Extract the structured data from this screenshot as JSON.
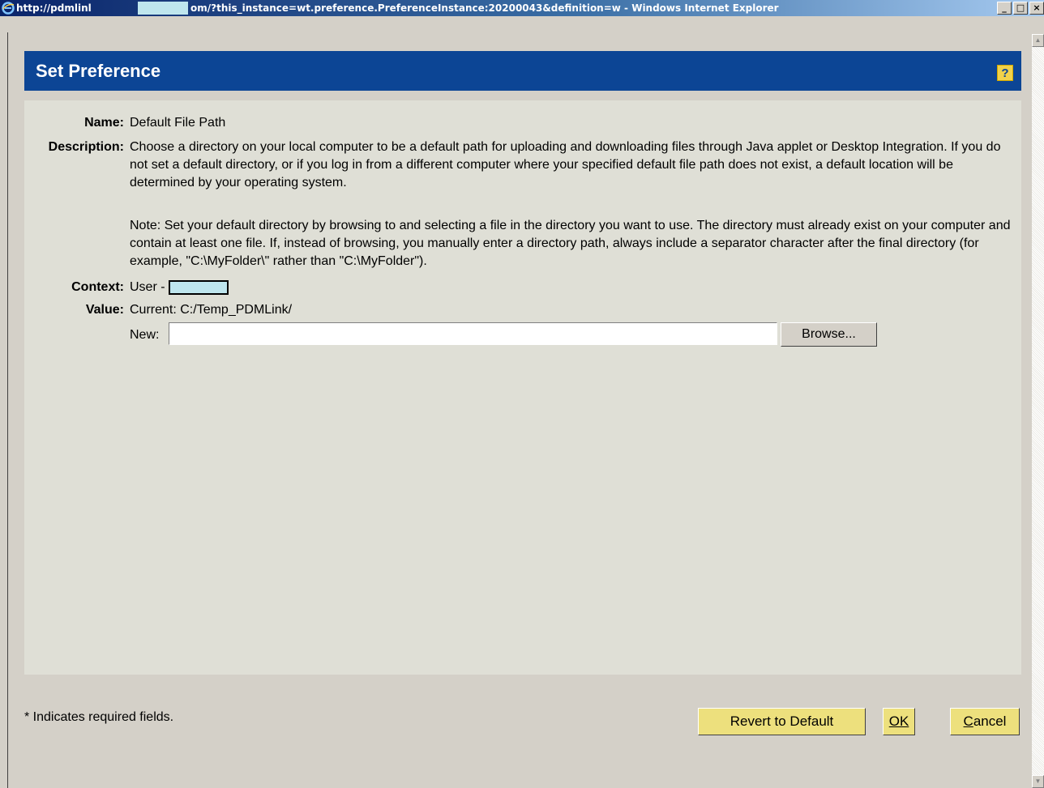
{
  "window": {
    "title_part1": "http://pdmlinl",
    "title_part2": "om/?this_instance=wt.preference.PreferenceInstance:20200043&definition=w - Windows Internet Explorer",
    "buttons": [
      "_",
      "□",
      "×"
    ]
  },
  "header": {
    "title": "Set Preference",
    "help_label": "?"
  },
  "fields": {
    "name_label": "Name:",
    "name_value": "Default File Path",
    "description_label": "Description:",
    "description_text": "Choose a directory on your local computer to be a default path for uploading and downloading files through Java applet or Desktop Integration. If you do not set a default directory, or if you log in from a different computer where your specified default file path does not exist, a default location will be determined by your operating system.",
    "note_text": "Note: Set your default directory by browsing to and selecting a file in the directory you want to use. The directory must already exist on your computer and contain at least one file. If, instead of browsing, you manually enter a directory path, always include a separator character after the final directory (for example, \"C:\\MyFolder\\\" rather than \"C:\\MyFolder\").",
    "context_label": "Context:",
    "context_value": "User -",
    "value_label": "Value:",
    "current_text": "Current: C:/Temp_PDMLink/",
    "new_label": "New:",
    "new_value": "",
    "browse_label": "Browse..."
  },
  "footer": {
    "required_note": "* Indicates required fields.",
    "revert_label": "Revert to Default",
    "ok_label": "OK",
    "cancel_prefix": "C",
    "cancel_rest": "ancel"
  },
  "colors": {
    "header_bg": "#0c4595",
    "panel_bg": "#dfdfd6",
    "button_bg": "#ede07d",
    "help_bg": "#f1d24a"
  }
}
